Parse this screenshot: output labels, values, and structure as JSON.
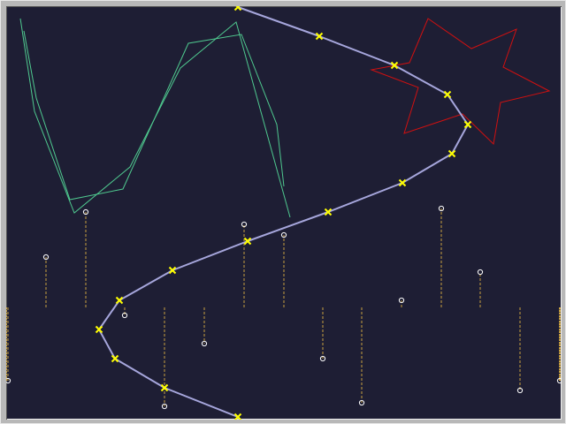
{
  "colors": {
    "background": "#1e1e34",
    "frame": "#b8b8b8",
    "curve": "#a6a6dc",
    "curve_marker": "#ffff00",
    "polyline": "#4fc98f",
    "star": "#d01010",
    "stem": "#c8a040",
    "stem_marker_stroke": "#ffffff"
  },
  "icons": {
    "curve_marker": "x-mark-icon",
    "stem_marker": "hollow-circle-icon"
  }
}
